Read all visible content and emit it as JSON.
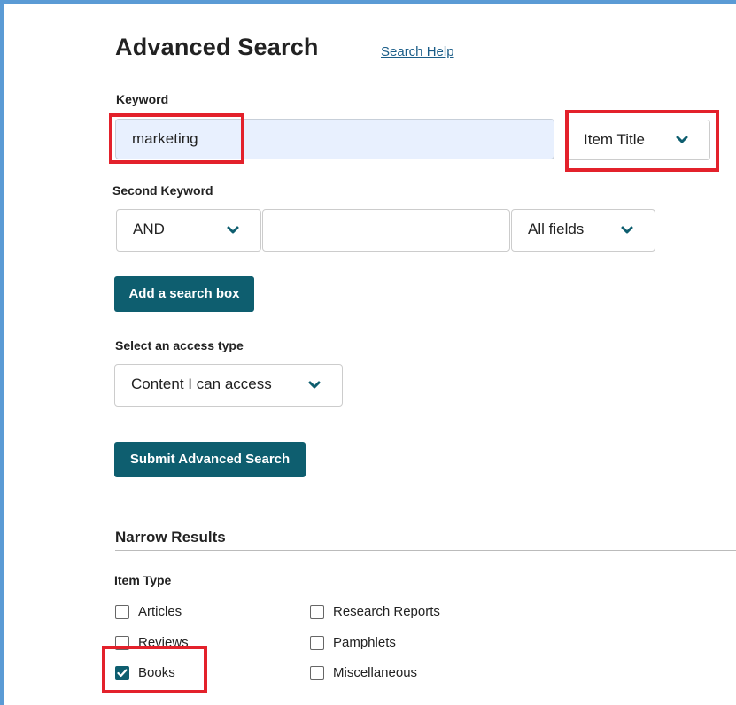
{
  "colors": {
    "accent_button": "#0e5e6f",
    "link": "#1a5d88",
    "highlight_annotation": "#e3212b",
    "frame": "#5b9bd5",
    "chevron": "#0e5e6f"
  },
  "header": {
    "title": "Advanced Search",
    "help_link": "Search Help"
  },
  "keyword": {
    "label": "Keyword",
    "value": "marketing",
    "field_select": "Item Title"
  },
  "second_keyword": {
    "label": "Second Keyword",
    "operator_select": "AND",
    "value": "",
    "field_select": "All fields"
  },
  "add_box_button": "Add a search box",
  "access": {
    "label": "Select an access type",
    "selected": "Content I can access"
  },
  "submit_button": "Submit Advanced Search",
  "narrow": {
    "title": "Narrow Results",
    "item_type_label": "Item Type",
    "left_options": [
      {
        "label": "Articles",
        "checked": false
      },
      {
        "label": "Reviews",
        "checked": false
      },
      {
        "label": "Books",
        "checked": true
      }
    ],
    "right_options": [
      {
        "label": "Research Reports",
        "checked": false
      },
      {
        "label": "Pamphlets",
        "checked": false
      },
      {
        "label": "Miscellaneous",
        "checked": false
      }
    ]
  },
  "icons": {
    "dropdown": "chevron-down-icon",
    "checkbox_checked": "checkmark-icon"
  }
}
